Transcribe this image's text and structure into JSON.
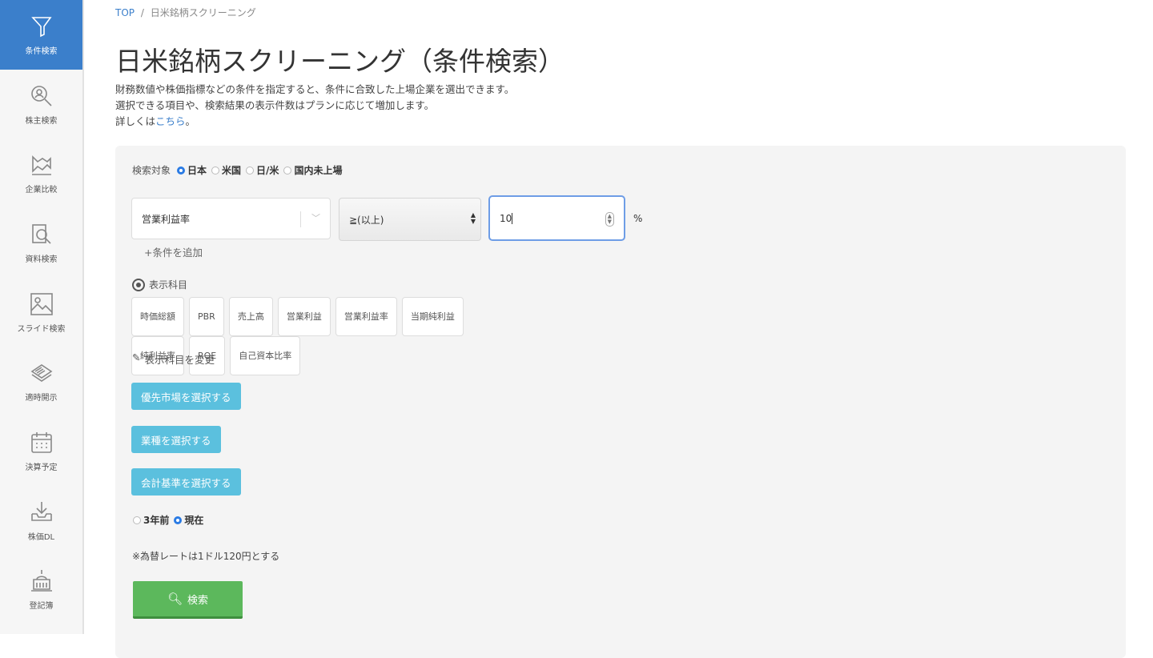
{
  "sidebar": {
    "items": [
      {
        "label": "条件検索",
        "icon": "funnel-icon",
        "active": true
      },
      {
        "label": "株主検索",
        "icon": "person-search-icon"
      },
      {
        "label": "企業比較",
        "icon": "chart-flag-icon"
      },
      {
        "label": "資料検索",
        "icon": "document-search-icon"
      },
      {
        "label": "スライド検索",
        "icon": "image-icon"
      },
      {
        "label": "適時開示",
        "icon": "newspaper-icon"
      },
      {
        "label": "決算予定",
        "icon": "calendar-icon"
      },
      {
        "label": "株価DL",
        "icon": "download-icon"
      },
      {
        "label": "登記簿",
        "icon": "building-icon"
      }
    ]
  },
  "breadcrumb": {
    "top": "TOP",
    "sep": "/",
    "current": "日米銘柄スクリーニング"
  },
  "title": "日米銘柄スクリーニング（条件検索）",
  "desc": {
    "line1": "財務数値や株価指標などの条件を指定すると、条件に合致した上場企業を選出できます。",
    "line2": "選択できる項目や、検索結果の表示件数はプランに応じて増加します。",
    "line3_pre": "詳しくは",
    "line3_link": "こちら",
    "line3_post": "。"
  },
  "form": {
    "target_label": "検索対象",
    "targets": [
      "日本",
      "米国",
      "日/米",
      "国内未上場"
    ],
    "selected_target": "日本",
    "condition_field": "営業利益率",
    "operator": "≧(以上)",
    "value": "10",
    "unit": "%",
    "add_condition": "+条件を追加",
    "display_label": "表示科目",
    "chips": [
      "時価総額",
      "PBR",
      "売上高",
      "営業利益",
      "営業利益率",
      "当期純利益",
      "純利益率",
      "ROE",
      "自己資本比率"
    ],
    "change_display": "表示科目を変更",
    "market_btn": "優先市場を選択する",
    "industry_btn": "業種を選択する",
    "accounting_btn": "会計基準を選択する",
    "periods": [
      "3年前",
      "現在"
    ],
    "selected_period": "現在",
    "fx_note": "※為替レートは1ドル120円とする",
    "search_btn": "検索"
  }
}
